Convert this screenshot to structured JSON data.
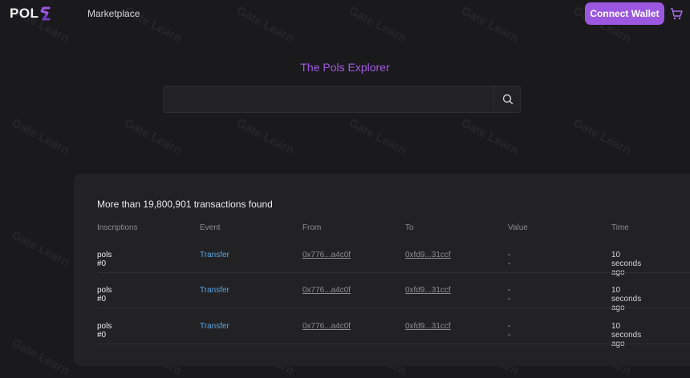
{
  "navbar": {
    "logo_text": "POL",
    "marketplace_label": "Marketplace",
    "connect_label": "Connect Wallet"
  },
  "hero": {
    "title": "The Pols Explorer",
    "search_value": ""
  },
  "results": {
    "count_text": "More than 19,800,901 transactions found",
    "columns": [
      "Inscriptions",
      "Event",
      "From",
      "To",
      "Value",
      "Time"
    ],
    "rows": [
      {
        "inscription": "pols  #0",
        "event": "Transfer",
        "from": "0x776...a4c0f",
        "to": "0xfd9...31ccf",
        "value": "--",
        "time": "10 seconds ago"
      },
      {
        "inscription": "pols  #0",
        "event": "Transfer",
        "from": "0x776...a4c0f",
        "to": "0xfd9...31ccf",
        "value": "--",
        "time": "10 seconds ago"
      },
      {
        "inscription": "pols  #0",
        "event": "Transfer",
        "from": "0x776...a4c0f",
        "to": "0xfd9...31ccf",
        "value": "--",
        "time": "10 seconds ago"
      }
    ]
  },
  "watermark_text": "Gate Learn",
  "colors": {
    "accent": "#9b57e0",
    "title": "#a25be6",
    "link": "#5ea4e0",
    "background": "#1a1a1c",
    "panel": "#222224"
  }
}
